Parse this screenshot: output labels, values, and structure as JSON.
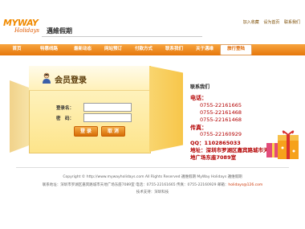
{
  "header": {
    "logo_main": "MYWAY",
    "logo_sub": "Holidays",
    "site_name": "邁維假期",
    "top_links": [
      "加入收藏",
      "设为首页",
      "联系我们"
    ]
  },
  "nav": {
    "items": [
      {
        "label": "首页",
        "active": false
      },
      {
        "label": "特惠线路",
        "active": false
      },
      {
        "label": "最新动态",
        "active": false
      },
      {
        "label": "网站预订",
        "active": false
      },
      {
        "label": "付款方式",
        "active": false
      },
      {
        "label": "联系我们",
        "active": false
      },
      {
        "label": "关于邁维",
        "active": false
      },
      {
        "label": "旅行登陆",
        "active": true
      }
    ]
  },
  "login": {
    "title": "会员登录",
    "username_label": "登录名：",
    "password_label": "密　码：",
    "username_value": "",
    "password_value": "",
    "login_button": "登 录",
    "cancel_button": "取 消"
  },
  "contact": {
    "heading": "联系我们",
    "phone_label": "电话：",
    "phones": [
      "0755-22161665",
      "0755-22161468",
      "0755-22161468"
    ],
    "fax_label": "传真：",
    "fax": "0755-22160929",
    "qq": "QQ：1102865033",
    "address_line1": "地址：深圳市罗湖区嘉宾路城市天",
    "address_line2": "地广场东座7089室"
  },
  "footer": {
    "line1": "Copyright © http://www.mywayholidays.com  All Rights Reserved  邁维假期  MyWay Holidays 邁维假期",
    "line2_prefix": "联系地址：深圳市罗湖区嘉宾路城市天地广场东座7089室 电话：0755-22161665 传真：0755-22160929 邮箱：",
    "line2_email": "holidays@126.com",
    "line3": "技术支持：深圳科技"
  }
}
